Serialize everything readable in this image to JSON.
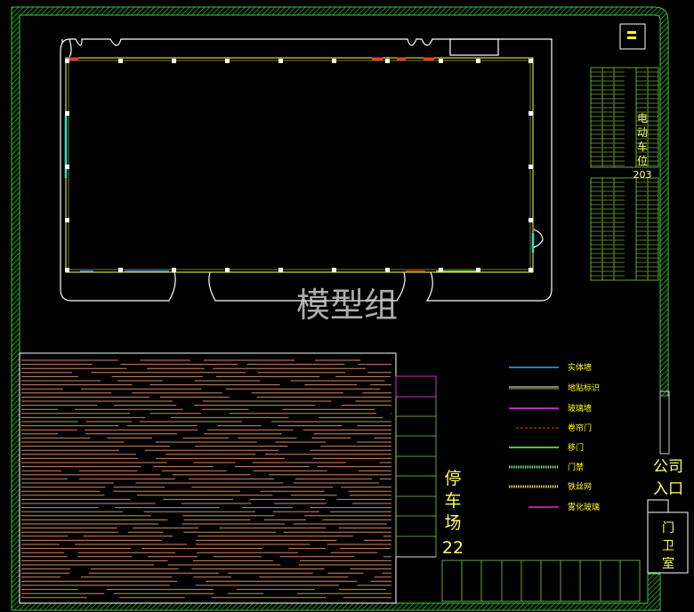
{
  "watermark": "模型组",
  "ev_parking": {
    "line1": "电",
    "line2": "动",
    "line3": "车",
    "line4": "位",
    "count": "203"
  },
  "parking_lot": {
    "line1": "停",
    "line2": "车",
    "line3": "场",
    "count": "22"
  },
  "entrance": {
    "line1": "公司",
    "line2": "入口"
  },
  "guard_room": {
    "line1": "门",
    "line2": "卫",
    "line3": "室"
  },
  "legend": [
    {
      "label": "实体墙",
      "color": "#33aaff",
      "style": "solid"
    },
    {
      "label": "地贴标识",
      "color": "#ffffcc",
      "style": "double"
    },
    {
      "label": "玻璃墙",
      "color": "#ff33ff",
      "style": "solid"
    },
    {
      "label": "卷帘门",
      "color": "#ff3333",
      "style": "dashed"
    },
    {
      "label": "移门",
      "color": "#66ff66",
      "style": "solid"
    },
    {
      "label": "门禁",
      "color": "#88ff88",
      "style": "hatched"
    },
    {
      "label": "铁丝网",
      "color": "#ffee66",
      "style": "hatched"
    },
    {
      "label": "雾化玻璃",
      "color": "#cc33cc",
      "style": "solid"
    }
  ],
  "colors": {
    "boundary": "#33cc33",
    "building": "#ffffff",
    "wall_yellow": "#ffff66",
    "parking_lines": "#cc8866",
    "ev_stalls": "#88cc44"
  }
}
